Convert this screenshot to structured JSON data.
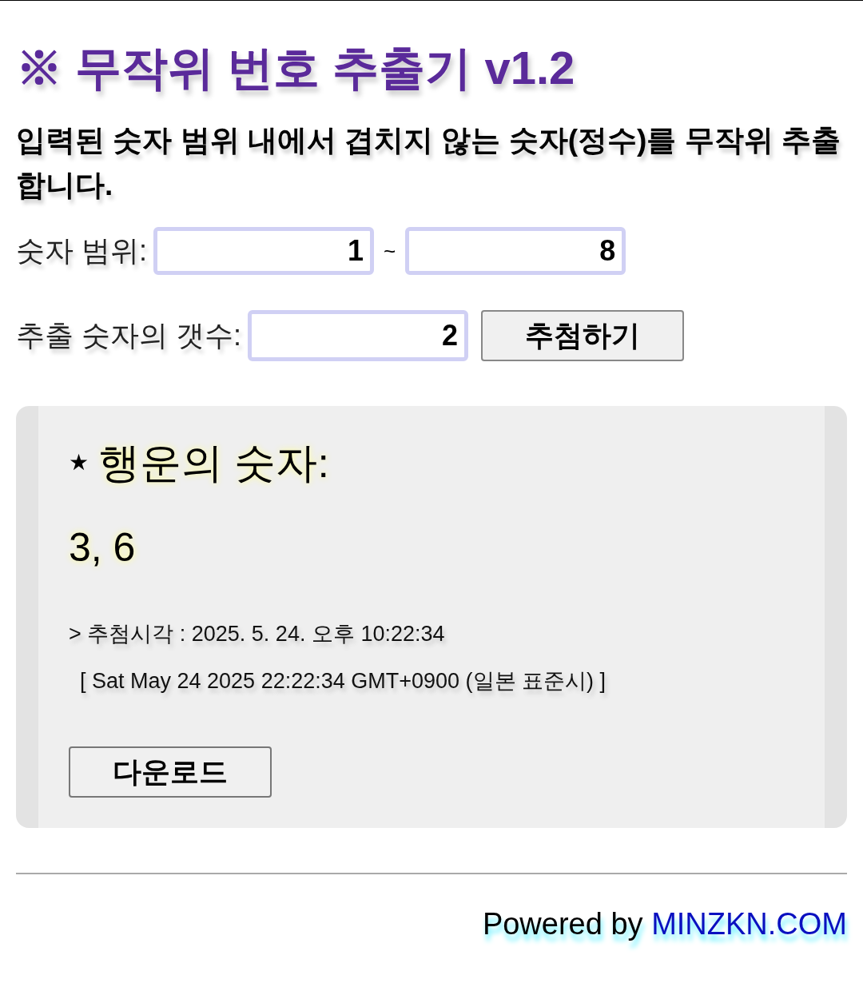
{
  "title": "※ 무작위 번호 추출기 v1.2",
  "description": "입력된 숫자 범위 내에서 겹치지 않는 숫자(정수)를 무작위 추출합니다.",
  "range": {
    "label": "숫자 범위:",
    "from": "1",
    "separator": "~",
    "to": "8"
  },
  "count": {
    "label": "추출 숫자의 갯수:",
    "value": "2",
    "button": "추첨하기"
  },
  "result": {
    "star": "★",
    "heading": "행운의 숫자:",
    "numbers": "3, 6",
    "time": "> 추첨시각 : 2025. 5. 24. 오후 10:22:34",
    "full_time": "[ Sat May 24 2025 22:22:34 GMT+0900 (일본 표준시) ]",
    "button": "다운로드"
  },
  "footer": {
    "text": "Powered by ",
    "link": "MINZKN.COM"
  }
}
